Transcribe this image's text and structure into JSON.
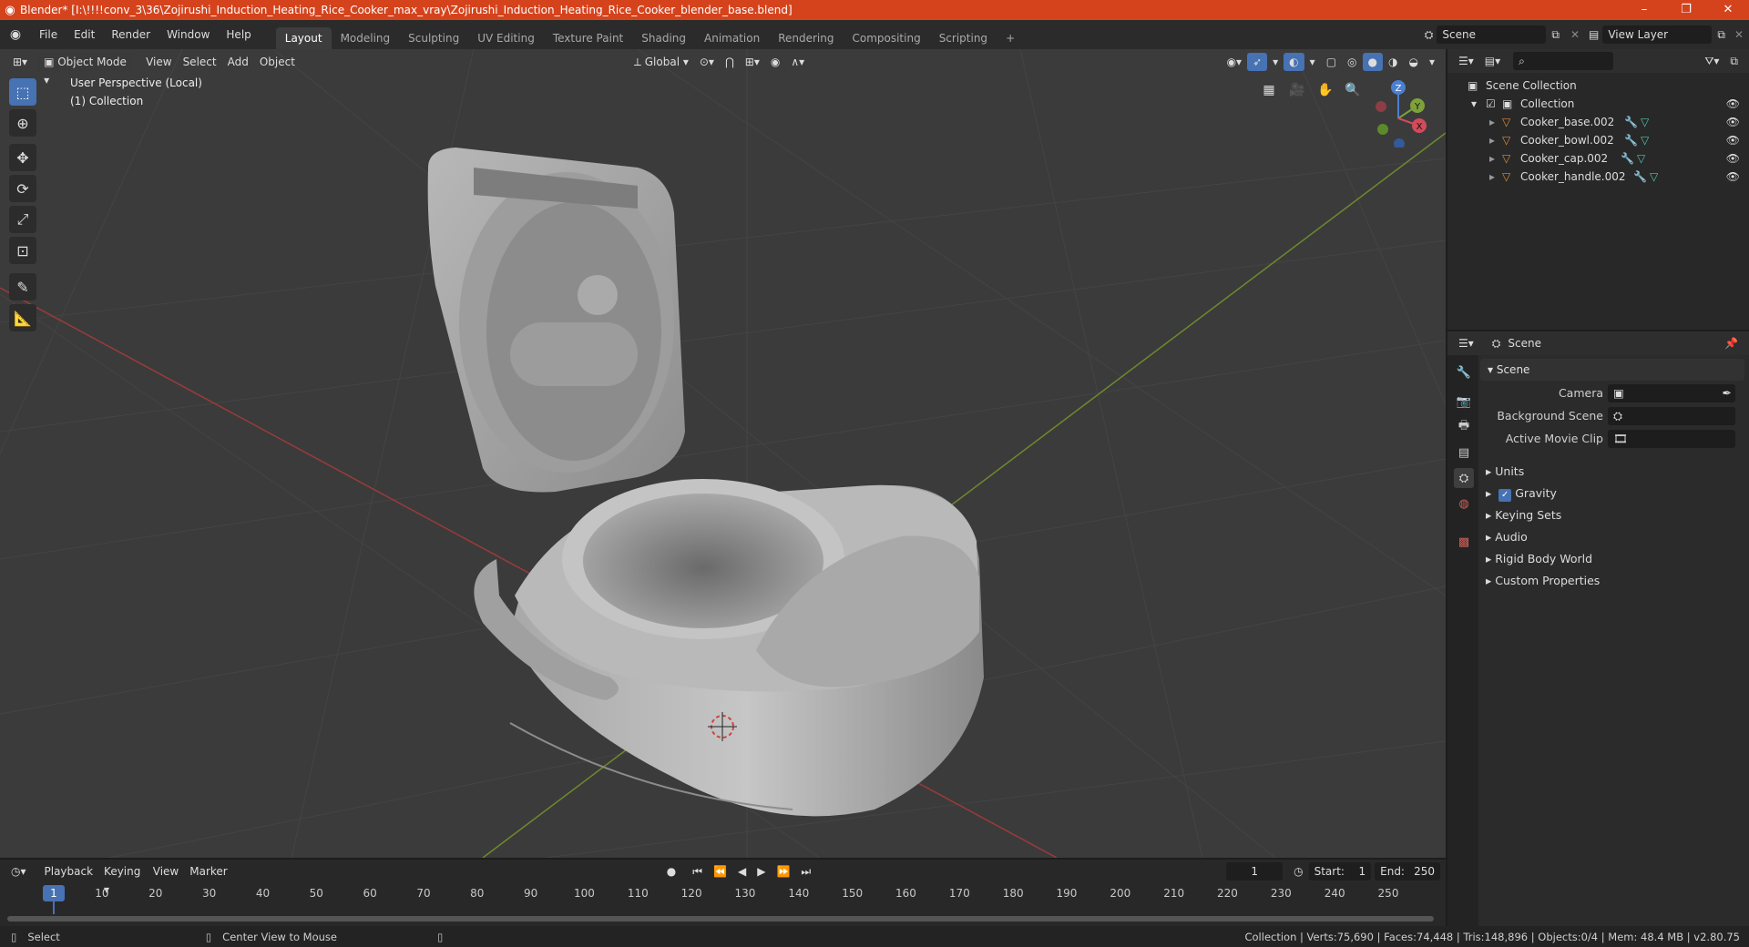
{
  "window": {
    "title": "Blender* [I:\\!!!!conv_3\\36\\Zojirushi_Induction_Heating_Rice_Cooker_max_vray\\Zojirushi_Induction_Heating_Rice_Cooker_blender_base.blend]",
    "minimize": "–",
    "maximize": "❐",
    "close": "✕"
  },
  "menu": {
    "items": [
      "File",
      "Edit",
      "Render",
      "Window",
      "Help"
    ]
  },
  "workspaces": [
    "Layout",
    "Modeling",
    "Sculpting",
    "UV Editing",
    "Texture Paint",
    "Shading",
    "Animation",
    "Rendering",
    "Compositing",
    "Scripting"
  ],
  "workspace_add": "+",
  "scene_selector": "Scene",
  "view_layer": "View Layer",
  "viewport": {
    "mode": "Object Mode",
    "menus": [
      "View",
      "Select",
      "Add",
      "Object"
    ],
    "transform_orientation": "Global",
    "overlay_line1": "User Perspective (Local)",
    "overlay_line2": "(1) Collection",
    "gizmo": {
      "z": "Z",
      "y": "Y",
      "x": "X"
    }
  },
  "outliner": {
    "root": "Scene Collection",
    "collection": "Collection",
    "objects": [
      "Cooker_base.002",
      "Cooker_bowl.002",
      "Cooker_cap.002",
      "Cooker_handle.002"
    ]
  },
  "properties": {
    "context": "Scene",
    "panel_title": "Scene",
    "fields": [
      {
        "label": "Camera"
      },
      {
        "label": "Background Scene"
      },
      {
        "label": "Active Movie Clip"
      }
    ],
    "sections": [
      "Units",
      "Gravity",
      "Keying Sets",
      "Audio",
      "Rigid Body World",
      "Custom Properties"
    ]
  },
  "timeline": {
    "menus": [
      "Playback",
      "Keying",
      "View",
      "Marker"
    ],
    "current_frame": "1",
    "start_label": "Start:",
    "start": "1",
    "end_label": "End:",
    "end": "250",
    "ticks": [
      "1",
      "10",
      "20",
      "30",
      "40",
      "50",
      "60",
      "70",
      "80",
      "90",
      "100",
      "110",
      "120",
      "130",
      "140",
      "150",
      "160",
      "170",
      "180",
      "190",
      "200",
      "210",
      "220",
      "230",
      "240",
      "250"
    ]
  },
  "status": {
    "select": "Select",
    "center": "Center View to Mouse",
    "stats": "Collection | Verts:75,690 | Faces:74,448 | Tris:148,896 | Objects:0/4 | Mem: 48.4 MB | v2.80.75"
  },
  "colors": {
    "titlebar": "#d5431d",
    "active_tool": "#4772b3",
    "viewport_bg": "#3b3b3b"
  }
}
